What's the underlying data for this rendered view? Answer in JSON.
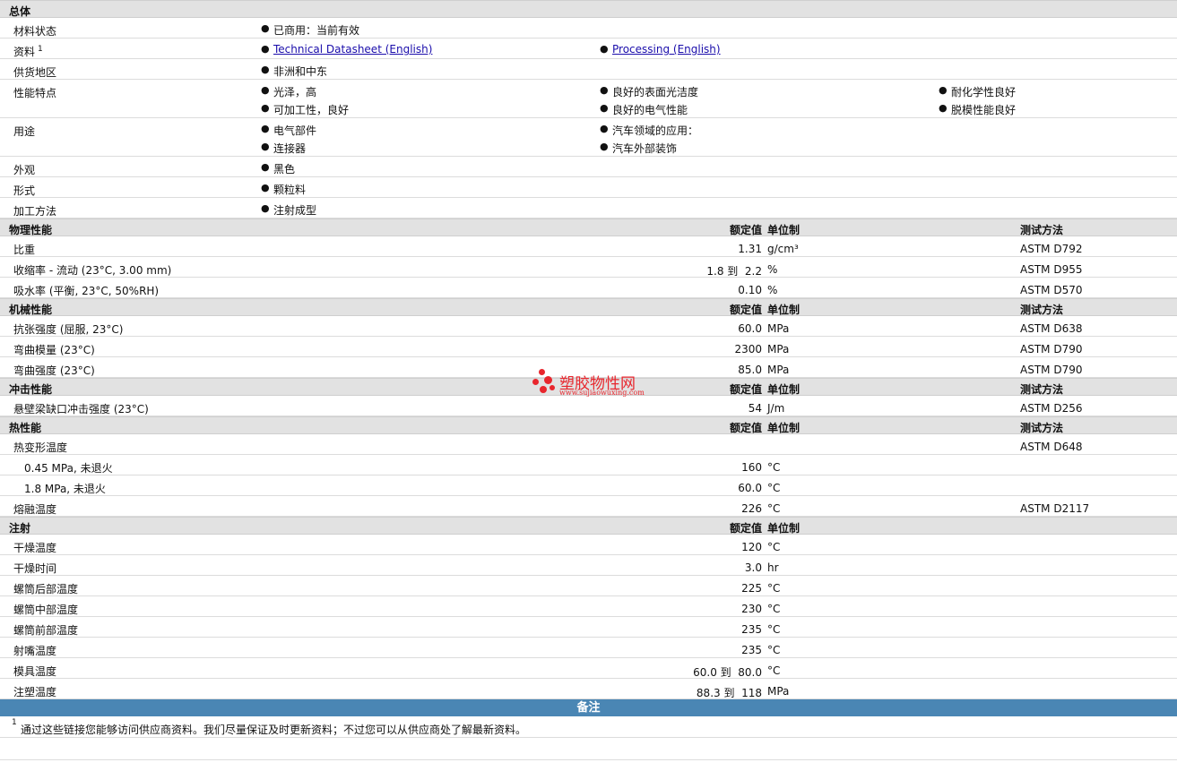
{
  "general": {
    "title": "总体",
    "status_label": "材料状态",
    "status_value": "已商用：当前有效",
    "docs_label": "资料",
    "docs_sup": "1",
    "docs_links": [
      "Technical Datasheet (English)",
      "Processing (English)"
    ],
    "region_label": "供货地区",
    "region_value": "非洲和中东",
    "features_label": "性能特点",
    "features": [
      "光泽，高",
      "良好的表面光洁度",
      "耐化学性良好",
      "可加工性，良好",
      "良好的电气性能",
      "脱模性能良好"
    ],
    "uses_label": "用途",
    "uses": [
      "电气部件",
      "汽车领域的应用：",
      "连接器",
      "汽车外部装饰"
    ],
    "appearance_label": "外观",
    "appearance_value": "黑色",
    "form_label": "形式",
    "form_value": "颗粒料",
    "method_label": "加工方法",
    "method_value": "注射成型"
  },
  "headers": {
    "rated": "额定值",
    "unit": "单位制",
    "test": "测试方法"
  },
  "physical": {
    "title": "物理性能",
    "rows": [
      {
        "label": "比重",
        "value": "1.31",
        "unit": "g/cm³",
        "method": "ASTM D792"
      },
      {
        "label": "收缩率 - 流动 (23°C, 3.00 mm)",
        "value": "1.8 到  2.2",
        "unit": "%",
        "method": "ASTM D955"
      },
      {
        "label": "吸水率 (平衡, 23°C, 50%RH)",
        "value": "0.10",
        "unit": "%",
        "method": "ASTM D570"
      }
    ]
  },
  "mechanical": {
    "title": "机械性能",
    "rows": [
      {
        "label": "抗张强度 (屈服, 23°C)",
        "value": "60.0",
        "unit": "MPa",
        "method": "ASTM D638"
      },
      {
        "label": "弯曲模量 (23°C)",
        "value": "2300",
        "unit": "MPa",
        "method": "ASTM D790"
      },
      {
        "label": "弯曲强度 (23°C)",
        "value": "85.0",
        "unit": "MPa",
        "method": "ASTM D790"
      }
    ]
  },
  "impact": {
    "title": "冲击性能",
    "rows": [
      {
        "label": "悬壁梁缺口冲击强度 (23°C)",
        "value": "54",
        "unit": "J/m",
        "method": "ASTM D256"
      }
    ]
  },
  "thermal": {
    "title": "热性能",
    "rows": [
      {
        "label": "热变形温度",
        "value": "",
        "unit": "",
        "method": "ASTM D648"
      },
      {
        "label": "0.45 MPa, 未退火",
        "value": "160",
        "unit": "°C",
        "method": ""
      },
      {
        "label": "1.8 MPa, 未退火",
        "value": "60.0",
        "unit": "°C",
        "method": ""
      },
      {
        "label": "熔融温度",
        "value": "226",
        "unit": "°C",
        "method": "ASTM D2117"
      }
    ]
  },
  "injection": {
    "title": "注射",
    "rows": [
      {
        "label": "干燥温度",
        "value": "120",
        "unit": "°C"
      },
      {
        "label": "干燥时间",
        "value": "3.0",
        "unit": "hr"
      },
      {
        "label": "螺筒后部温度",
        "value": "225",
        "unit": "°C"
      },
      {
        "label": "螺筒中部温度",
        "value": "230",
        "unit": "°C"
      },
      {
        "label": "螺筒前部温度",
        "value": "235",
        "unit": "°C"
      },
      {
        "label": "射嘴温度",
        "value": "235",
        "unit": "°C"
      },
      {
        "label": "模具温度",
        "value": "60.0 到  80.0",
        "unit": "°C"
      },
      {
        "label": "注塑温度",
        "value": "88.3 到  118",
        "unit": "MPa"
      }
    ]
  },
  "notes": {
    "title": "备注",
    "sup": "1",
    "text": "通过这些链接您能够访问供应商资料。我们尽量保证及时更新资料；不过您可以从供应商处了解最新资料。"
  },
  "watermark": {
    "name": "塑胶物性网",
    "url": "www.sujiaowuxing.com",
    "color": "#e8262d"
  },
  "colors": {
    "section_bg": "#e2e2e2",
    "notes_bar": "#4a86b4",
    "link": "#1a0dab"
  }
}
